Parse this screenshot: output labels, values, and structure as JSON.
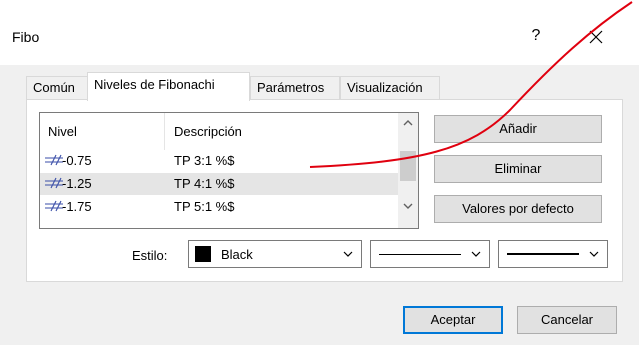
{
  "window": {
    "title": "Fibo",
    "help_glyph": "?"
  },
  "tabs": [
    {
      "label": "Común"
    },
    {
      "label": "Niveles de Fibonachi"
    },
    {
      "label": "Parámetros"
    },
    {
      "label": "Visualización"
    }
  ],
  "levels_table": {
    "columns": [
      "Nivel",
      "Descripción"
    ],
    "rows": [
      {
        "level": "-0.75",
        "description": "TP 3:1 %$"
      },
      {
        "level": "-1.25",
        "description": "TP 4:1 %$"
      },
      {
        "level": "-1.75",
        "description": "TP 5:1 %$"
      }
    ]
  },
  "side_buttons": {
    "add": "Añadir",
    "remove": "Eliminar",
    "defaults": "Valores por defecto"
  },
  "style_row": {
    "label": "Estilo:",
    "color_name": "Black",
    "color_value": "#000000"
  },
  "footer": {
    "ok": "Aceptar",
    "cancel": "Cancelar"
  },
  "colors": {
    "annotation_line": "#e0000f",
    "primary_border": "#0078d7",
    "selected_row": "#e5e5e5"
  }
}
